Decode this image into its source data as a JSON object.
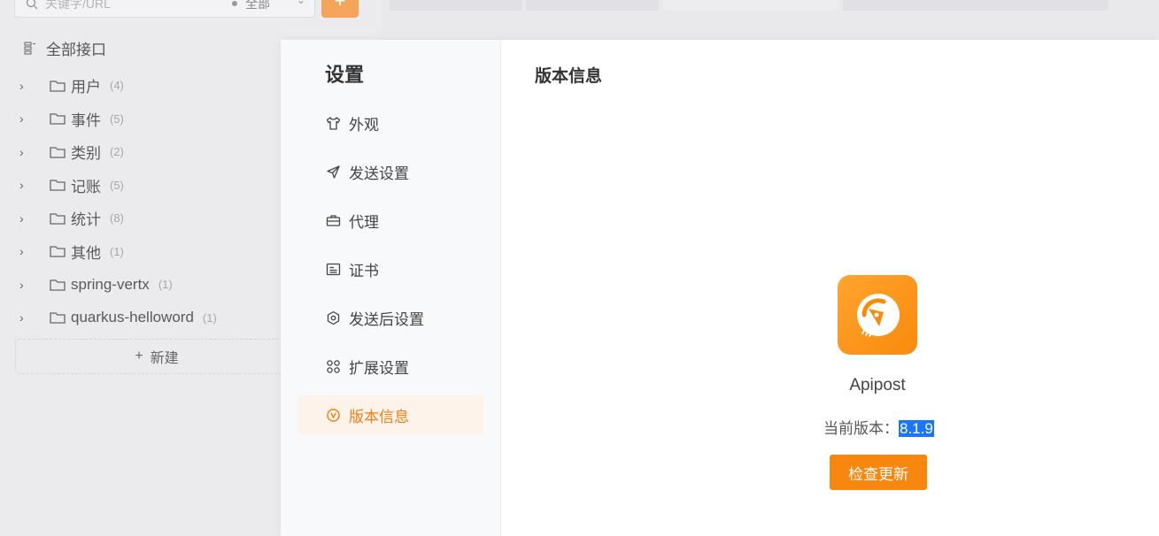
{
  "sidebar": {
    "search_placeholder": "关键字/URL",
    "scope": "全部",
    "add_label": "+",
    "all_api_label": "全部接口",
    "tree": [
      {
        "name": "用户",
        "count": "(4)"
      },
      {
        "name": "事件",
        "count": "(5)"
      },
      {
        "name": "类别",
        "count": "(2)"
      },
      {
        "name": "记账",
        "count": "(5)"
      },
      {
        "name": "统计",
        "count": "(8)"
      },
      {
        "name": "其他",
        "count": "(1)"
      },
      {
        "name": "spring-vertx",
        "count": "(1)"
      },
      {
        "name": "quarkus-helloword",
        "count": "(1)"
      }
    ],
    "new_label": "新建"
  },
  "settings": {
    "title": "设置",
    "nav": [
      {
        "label": "外观",
        "icon": "shirt-icon"
      },
      {
        "label": "发送设置",
        "icon": "send-icon"
      },
      {
        "label": "代理",
        "icon": "briefcase-icon"
      },
      {
        "label": "证书",
        "icon": "certificate-icon"
      },
      {
        "label": "发送后设置",
        "icon": "hexagon-settings-icon"
      },
      {
        "label": "扩展设置",
        "icon": "extensions-icon"
      },
      {
        "label": "版本信息",
        "icon": "version-icon",
        "active": true
      }
    ],
    "accent_color": "#f57e12"
  },
  "version_panel": {
    "title": "版本信息",
    "app_name": "Apipost",
    "version_label": "当前版本：",
    "version_value": "8.1.9",
    "check_update_label": "检查更新"
  }
}
